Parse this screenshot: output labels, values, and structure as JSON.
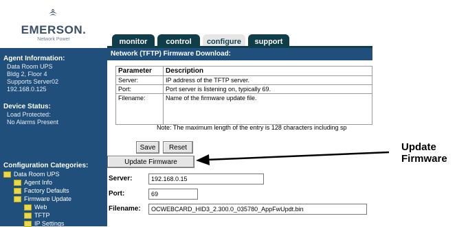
{
  "brand": {
    "name": "EMERSON.",
    "subtitle": "Network Power"
  },
  "tabs": [
    {
      "label": "monitor",
      "active": false
    },
    {
      "label": "control",
      "active": false
    },
    {
      "label": "configure",
      "active": true
    },
    {
      "label": "support",
      "active": false
    }
  ],
  "sidebar": {
    "agent_heading": "Agent Information:",
    "agent_lines": [
      "Data Room UPS",
      "Bldg 2, Floor 4",
      "Supports Server02",
      "192.168.0.125"
    ],
    "device_heading": "Device Status:",
    "device_lines": [
      "Load Protected:",
      "No Alarms Present"
    ],
    "config_heading": "Configuration Categories:",
    "tree": [
      "Data Room UPS",
      "Agent Info",
      "Factory Defaults",
      "Firmware Update",
      "Web",
      "TFTP",
      "IP Settings"
    ]
  },
  "main": {
    "title": "Network (TFTP) Firmware Download:",
    "table": {
      "headers": [
        "Parameter",
        "Description"
      ],
      "rows": [
        [
          "Server:",
          "IP address of the TFTP server."
        ],
        [
          "Port:",
          "Port server is listening on, typically 69."
        ],
        [
          "Filename:",
          "Name of the firmware update file."
        ]
      ],
      "note": "Note: The maximum length of the entry is 128 characters including sp"
    },
    "buttons": {
      "save": "Save",
      "reset": "Reset",
      "update_firmware": "Update Firmware"
    },
    "form": {
      "server_label": "Server:",
      "server_value": "192.168.0.15",
      "port_label": "Port:",
      "port_value": "69",
      "filename_label": "Filename:",
      "filename_value": "OCWEBCARD_HID3_2.300.0_035780_AppFwUpdt.bin"
    }
  },
  "callout": {
    "line1": "Update",
    "line2": "Firmware"
  }
}
